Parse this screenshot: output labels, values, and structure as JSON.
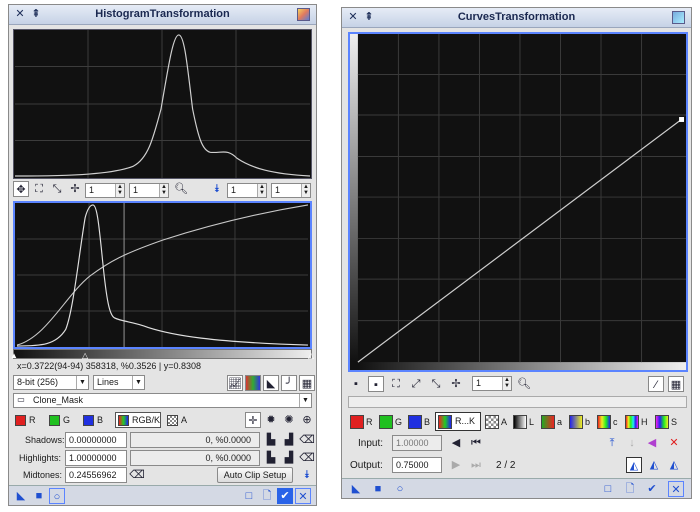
{
  "histogram": {
    "title": "HistogramTransformation",
    "zoom": {
      "h": "1",
      "v": "1",
      "h2": "1",
      "v2": "1"
    },
    "readout": "x=0.3722(94-94) 358318, %0.3526 | y=0.8308",
    "resolution": "8-bit (256)",
    "graph_style": "Lines",
    "view": "Clone_Mask",
    "channels": {
      "r": "R",
      "g": "G",
      "b": "B",
      "rgbk": "RGB/K",
      "a": "A"
    },
    "shadows": {
      "label": "Shadows:",
      "value": "0.00000000",
      "clip": "0, %0.0000"
    },
    "highlights": {
      "label": "Highlights:",
      "value": "1.00000000",
      "clip": "0, %0.0000"
    },
    "midtones": {
      "label": "Midtones:",
      "value": "0.24556962"
    },
    "auto_clip": "Auto Clip Setup"
  },
  "curves": {
    "title": "CurvesTransformation",
    "zoom": "1",
    "channels": {
      "r": "R",
      "g": "G",
      "b": "B",
      "rk": "R...K",
      "a": "A",
      "l": "L",
      "a2": "a",
      "b2": "b",
      "c": "c",
      "h": "H",
      "s": "S"
    },
    "input": {
      "label": "Input:",
      "value": "1.00000"
    },
    "output": {
      "label": "Output:",
      "value": "0.75000"
    },
    "point_index": "2 / 2"
  },
  "colors": {
    "accent": "#1f4fd0",
    "selection": "#5b84ff"
  }
}
